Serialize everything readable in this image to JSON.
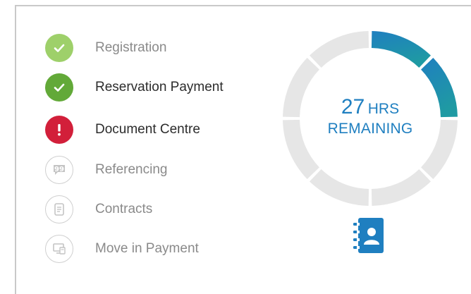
{
  "steps": [
    {
      "label": "Registration",
      "status": "complete",
      "icon": "check-icon",
      "color": "#9ed06a"
    },
    {
      "label": "Reservation Payment",
      "status": "complete",
      "icon": "check-icon",
      "color": "#62a938"
    },
    {
      "label": "Document Centre",
      "status": "action-required",
      "icon": "exclamation-icon",
      "color": "#d21f3a"
    },
    {
      "label": "Referencing",
      "status": "pending",
      "icon": "speech-bubble-icon"
    },
    {
      "label": "Contracts",
      "status": "pending",
      "icon": "scroll-icon"
    },
    {
      "label": "Move in Payment",
      "status": "pending",
      "icon": "computer-payment-icon"
    }
  ],
  "countdown": {
    "value": "27",
    "unit": "HRS",
    "caption": "REMAINING",
    "progress_segments_filled": 2,
    "progress_segments_total": 8,
    "accent_color": "#1f7fc0",
    "gradient_end_color": "#1f9aa3"
  },
  "bottom_icon": {
    "icon": "contact-book-icon",
    "color": "#1f7fc0"
  }
}
